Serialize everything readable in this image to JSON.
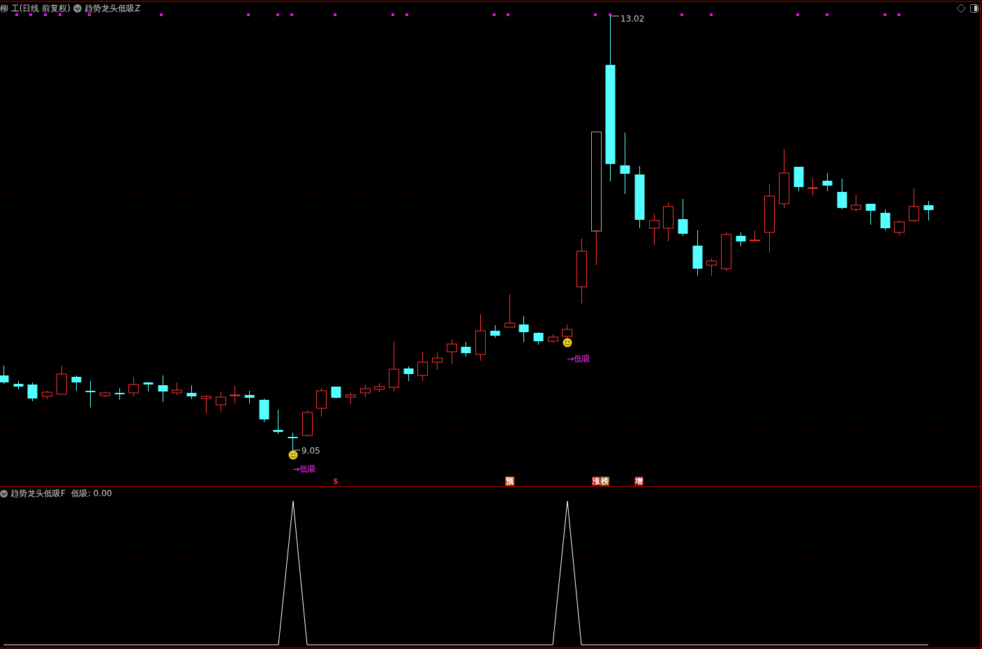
{
  "chart_header": {
    "title": "柳 工(日线 前复权)",
    "indicator": "趋势龙头低吸Z"
  },
  "price_labels": [
    {
      "text": "13.02"
    },
    {
      "text": "9.05"
    }
  ],
  "signals": [
    {
      "text": "→低吸"
    },
    {
      "text": "→低吸"
    }
  ],
  "markers": [
    {
      "text": "$",
      "kind": "plain",
      "color": "#ff2020"
    },
    {
      "text": "预",
      "kind": "tag",
      "color": "#c85a14"
    },
    {
      "text": "涨",
      "kind": "tag",
      "color": "#a01010"
    },
    {
      "text": "榜",
      "kind": "tag",
      "color": "#9a5a10"
    },
    {
      "text": "增",
      "kind": "tag",
      "color": "#a01010"
    }
  ],
  "indicator_panel": {
    "name": "趋势龙头低吸F",
    "reading": "低吸: 0.00"
  }
}
